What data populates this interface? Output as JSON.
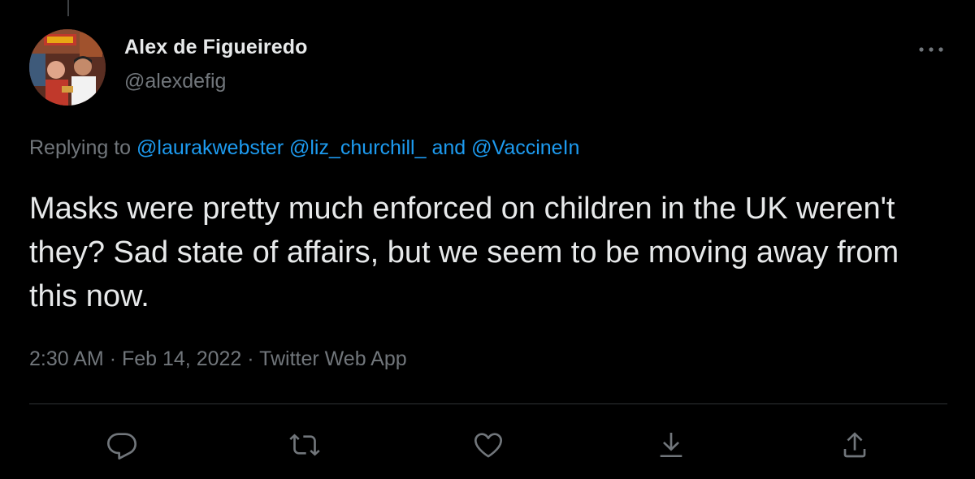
{
  "author": {
    "name": "Alex de Figueiredo",
    "handle": "@alexdefig"
  },
  "more_icon": "ellipsis-icon",
  "reply_context": {
    "prefix": "Replying to ",
    "mention1": "@laurakwebster",
    "mention2": "@liz_churchill_",
    "conjunction": "and",
    "mention3": "@VaccineIn"
  },
  "tweet": {
    "text": "Masks were pretty much enforced on children in the UK weren't they? Sad state of affairs, but we seem to be moving away from this now."
  },
  "meta": {
    "time": "2:30 AM",
    "separator": "·",
    "date": "Feb 14, 2022",
    "source": "Twitter Web App"
  },
  "actions": [
    {
      "name": "reply",
      "icon": "reply-icon"
    },
    {
      "name": "retweet",
      "icon": "retweet-icon"
    },
    {
      "name": "like",
      "icon": "heart-icon"
    },
    {
      "name": "bookmark",
      "icon": "download-icon"
    },
    {
      "name": "share",
      "icon": "share-icon"
    }
  ],
  "colors": {
    "background": "#000000",
    "text": "#e7e9ea",
    "secondary": "#71767b",
    "accent": "#1d9bf0",
    "divider": "#2f3336"
  }
}
